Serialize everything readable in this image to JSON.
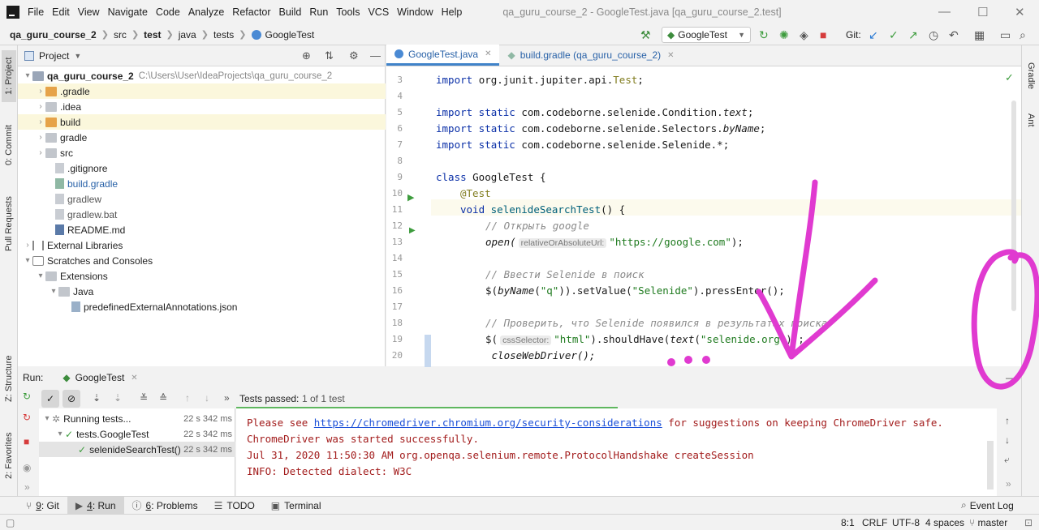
{
  "menu": [
    "File",
    "Edit",
    "View",
    "Navigate",
    "Code",
    "Analyze",
    "Refactor",
    "Build",
    "Run",
    "Tools",
    "VCS",
    "Window",
    "Help"
  ],
  "window_title": "qa_guru_course_2 - GoogleTest.java [qa_guru_course_2.test]",
  "breadcrumbs": [
    "qa_guru_course_2",
    "src",
    "test",
    "java",
    "tests",
    "GoogleTest"
  ],
  "run_config": "GoogleTest",
  "git_label": "Git:",
  "left_tabs": [
    "1: Project",
    "0: Commit",
    "Pull Requests",
    "Z: Structure",
    "2: Favorites"
  ],
  "right_tabs": [
    "Gradle",
    "Ant"
  ],
  "project": {
    "header": "Project",
    "root_name": "qa_guru_course_2",
    "root_path": "C:\\Users\\User\\IdeaProjects\\qa_guru_course_2",
    "items": [
      {
        "label": ".gradle"
      },
      {
        "label": ".idea"
      },
      {
        "label": "build"
      },
      {
        "label": "gradle"
      },
      {
        "label": "src"
      },
      {
        "label": ".gitignore"
      },
      {
        "label": "build.gradle"
      },
      {
        "label": "gradlew"
      },
      {
        "label": "gradlew.bat"
      },
      {
        "label": "README.md"
      },
      {
        "label": "External Libraries"
      },
      {
        "label": "Scratches and Consoles"
      },
      {
        "label": "Extensions"
      },
      {
        "label": "Java"
      },
      {
        "label": "predefinedExternalAnnotations.json"
      }
    ]
  },
  "editor": {
    "tabs": [
      "GoogleTest.java",
      "build.gradle (qa_guru_course_2)"
    ],
    "line_numbers": [
      "3",
      "4",
      "5",
      "6",
      "7",
      "8",
      "9",
      "10",
      "11",
      "12",
      "13",
      "14",
      "15",
      "16",
      "17",
      "18",
      "19",
      "20"
    ],
    "code": {
      "l3a": "import ",
      "l3b": "org.junit.jupiter.api.",
      "l3c": "Test",
      "l3d": ";",
      "l5a": "import static ",
      "l5b": "com.codeborne.selenide.Condition.",
      "l5c": "text",
      "l5d": ";",
      "l6a": "import static ",
      "l6b": "com.codeborne.selenide.Selectors.",
      "l6c": "byName",
      "l6d": ";",
      "l7a": "import static ",
      "l7b": "com.codeborne.selenide.Selenide.*;",
      "l9a": "class ",
      "l9b": "GoogleTest {",
      "l10": "@Test",
      "l11a": "void ",
      "l11b": "selenideSearchTest",
      "l11c": "() {",
      "l12": "// Открыть google",
      "l13a": "open(",
      "l13hint": "relativeOrAbsoluteUrl:",
      "l13str": "\"https://google.com\"",
      "l13b": ");",
      "l15": "// Ввести Selenide в поиск",
      "l16a": "$(",
      "l16b": "byName",
      "l16c": "(",
      "l16d": "\"q\"",
      "l16e": ")).setValue(",
      "l16f": "\"Selenide\"",
      "l16g": ").pressEnter();",
      "l18": "// Проверить, что Selenide появился в результатах поиска",
      "l19a": "$(",
      "l19hint": "cssSelector:",
      "l19b": "\"html\"",
      "l19c": ").shouldHave(",
      "l19d": "text",
      "l19e": "(",
      "l19f": "\"selenide.org\"",
      "l19g": "));",
      "l20": " closeWebDriver();"
    }
  },
  "run": {
    "label": "Run:",
    "tab": "GoogleTest",
    "tests_passed_label": "Tests passed:",
    "tests_passed_count": "1 of 1 test",
    "tree": [
      {
        "label": "Running tests...",
        "time": "22 s 342 ms"
      },
      {
        "label": "tests.GoogleTest",
        "time": "22 s 342 ms"
      },
      {
        "label": "selenideSearchTest()",
        "time": "22 s 342 ms"
      }
    ],
    "console": {
      "l1a": "Please see ",
      "l1link": "https://chromedriver.chromium.org/security-considerations",
      "l1b": " for suggestions on keeping ChromeDriver safe.",
      "l2": "ChromeDriver was started successfully.",
      "l3": "Jul 31, 2020 11:50:30 AM org.openqa.selenium.remote.ProtocolHandshake createSession",
      "l4": "INFO: Detected dialect: W3C"
    },
    "progress": 0.5
  },
  "bottom_tabs": [
    {
      "num": "9",
      "label": ": Git"
    },
    {
      "num": "4",
      "label": ": Run"
    },
    {
      "num": "6",
      "label": ": Problems"
    },
    {
      "num": "",
      "label": "TODO"
    },
    {
      "num": "",
      "label": "Terminal"
    }
  ],
  "event_log": "Event Log",
  "status": {
    "position": "8:1",
    "line_sep": "CRLF",
    "encoding": "UTF-8",
    "indent": "4 spaces",
    "branch": "master"
  },
  "colors": {
    "annotation_magenta": "#e03ad0",
    "accent_blue": "#4083c9",
    "pass_green": "#5fb75f"
  }
}
